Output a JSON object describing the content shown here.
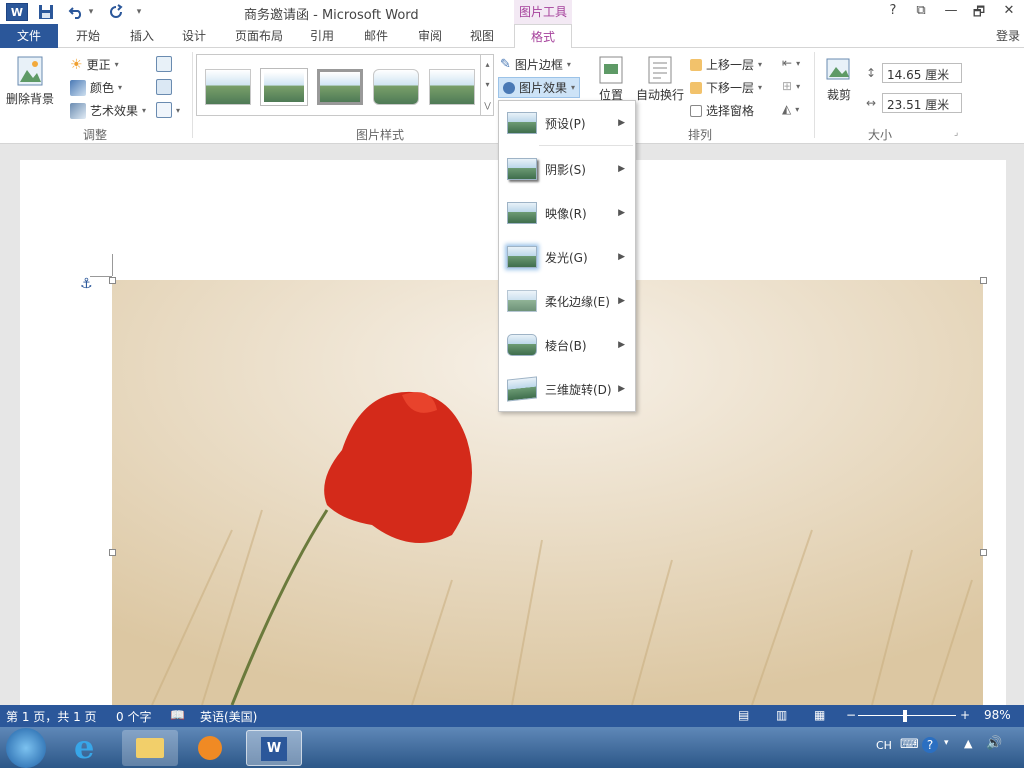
{
  "window": {
    "title": "商务邀请函 - Microsoft Word",
    "contextual_tab_group": "图片工具",
    "help": "?",
    "restore": "⧉",
    "minimize": "—",
    "maximize": "🗗",
    "close": "✕"
  },
  "qat": {
    "word_logo": "W",
    "undo_arrow": "▾",
    "customize": "▾"
  },
  "tabs": [
    {
      "label": "文件"
    },
    {
      "label": "开始"
    },
    {
      "label": "插入"
    },
    {
      "label": "设计"
    },
    {
      "label": "页面布局"
    },
    {
      "label": "引用"
    },
    {
      "label": "邮件"
    },
    {
      "label": "审阅"
    },
    {
      "label": "视图"
    },
    {
      "label": "格式"
    }
  ],
  "login": "登录",
  "ribbon": {
    "adjust": {
      "remove_bg": "删除背景",
      "corrections": "更正",
      "color": "颜色",
      "artistic": "艺术效果",
      "label": "调整"
    },
    "styles": {
      "label": "图片样式",
      "border": "图片边框",
      "effects": "图片效果"
    },
    "arrange": {
      "position": "位置",
      "wrap": "自动换行",
      "bring_forward": "上移一层",
      "send_backward": "下移一层",
      "selection_pane": "选择窗格",
      "label": "排列"
    },
    "size": {
      "crop": "裁剪",
      "height": "14.65 厘米",
      "width": "23.51 厘米",
      "label": "大小"
    }
  },
  "effects_menu": [
    {
      "label": "预设(P)"
    },
    {
      "label": "阴影(S)"
    },
    {
      "label": "映像(R)"
    },
    {
      "label": "发光(G)"
    },
    {
      "label": "柔化边缘(E)"
    },
    {
      "label": "棱台(B)"
    },
    {
      "label": "三维旋转(D)"
    }
  ],
  "status": {
    "page": "第 1 页，共 1 页",
    "words": "0 个字",
    "language": "英语(美国)",
    "zoom": "98%"
  },
  "taskbar": {
    "ime": "CH",
    "help": "?"
  },
  "colors": {
    "word_blue": "#2b579a",
    "picture_tools_purple": "#a6429c"
  }
}
